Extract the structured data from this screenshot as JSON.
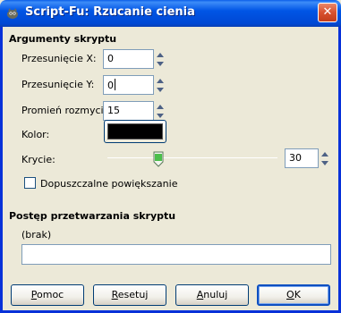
{
  "window": {
    "title": "Script-Fu: Rzucanie cienia",
    "close_symbol": "✕"
  },
  "arguments": {
    "heading": "Argumenty skryptu",
    "offset_x": {
      "label": "Przesunięcie X:",
      "value": "0"
    },
    "offset_y": {
      "label": "Przesunięcie Y:",
      "value": "0"
    },
    "blur_radius": {
      "label": "Promień rozmycia:",
      "value": "15"
    },
    "color": {
      "label": "Kolor:",
      "value": "#000000"
    },
    "opacity": {
      "label": "Krycie:",
      "value": "30",
      "fraction": 0.3
    },
    "allow_resize": {
      "label": "Dopuszczalne powiększanie",
      "checked": false
    }
  },
  "progress": {
    "heading": "Postęp przetwarzania skryptu",
    "status": "(brak)"
  },
  "buttons": {
    "help": {
      "label": "Pomoc",
      "mnemonic": "P",
      "rest": "omoc"
    },
    "reset": {
      "label": "Resetuj",
      "mnemonic": "R",
      "rest": "esetuj"
    },
    "cancel": {
      "label": "Anuluj",
      "mnemonic": "A",
      "rest": "nuluj"
    },
    "ok": {
      "label": "OK",
      "mnemonic": "O",
      "rest": "K"
    }
  },
  "colors": {
    "titlebar": "#0055e5",
    "dialog_bg": "#ece9d8",
    "swatch": "#000000"
  }
}
